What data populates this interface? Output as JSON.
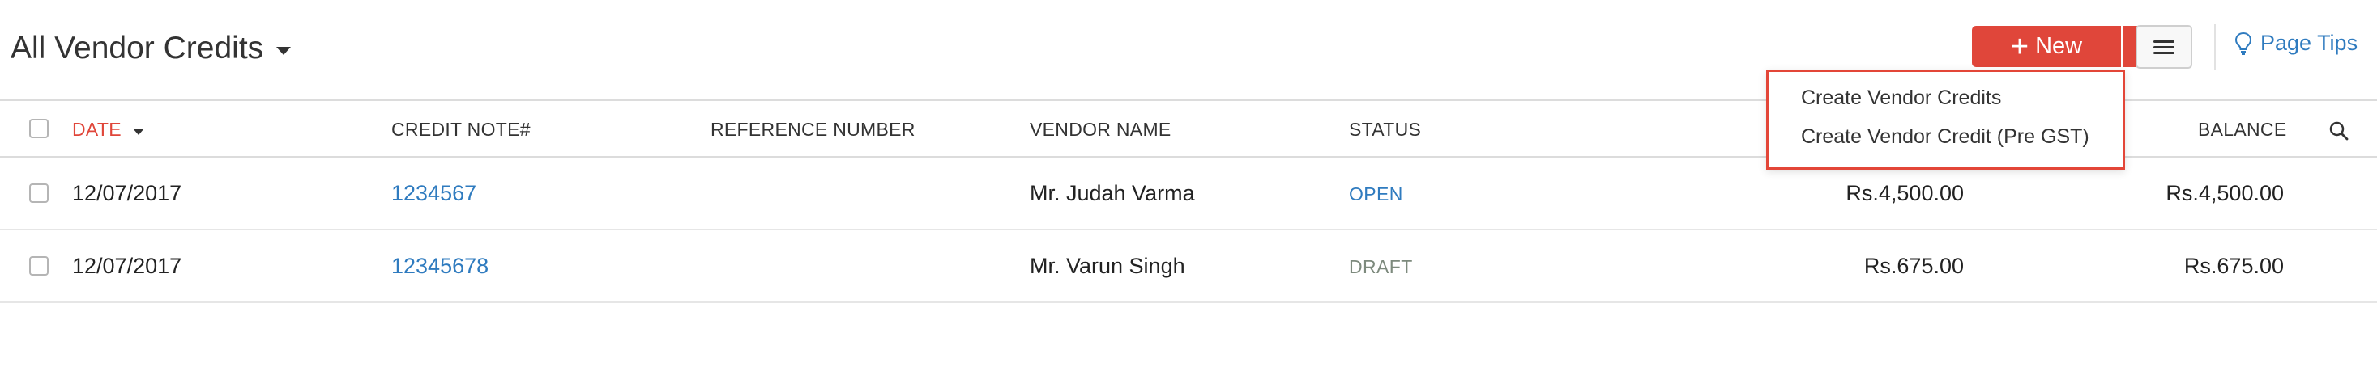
{
  "view": {
    "title": "All Vendor Credits"
  },
  "toolbar": {
    "new_label": "New",
    "page_tips_label": "Page Tips"
  },
  "new_menu": {
    "items": [
      "Create Vendor Credits",
      "Create Vendor Credit (Pre GST)"
    ]
  },
  "table": {
    "columns": {
      "date": "DATE",
      "credit_note": "CREDIT NOTE#",
      "reference_number": "REFERENCE NUMBER",
      "vendor_name": "VENDOR NAME",
      "status": "STATUS",
      "balance": "BALANCE"
    },
    "rows": [
      {
        "date": "12/07/2017",
        "credit_note": "1234567",
        "reference_number": "",
        "vendor_name": "Mr. Judah Varma",
        "status": "OPEN",
        "amount": "Rs.4,500.00",
        "balance": "Rs.4,500.00"
      },
      {
        "date": "12/07/2017",
        "credit_note": "12345678",
        "reference_number": "",
        "vendor_name": "Mr. Varun Singh",
        "status": "DRAFT",
        "amount": "Rs.675.00",
        "balance": "Rs.675.00"
      }
    ]
  },
  "colors": {
    "accent": "#e0463a",
    "link": "#2f7bbf",
    "status_open": "#2f7bbf",
    "status_draft": "#7d8a7d"
  },
  "icons": {
    "view_caret": "caret-down-icon",
    "new_plus": "plus-icon",
    "new_caret": "caret-down-icon",
    "menu": "hamburger-menu-icon",
    "page_tips": "lightbulb-icon",
    "sort": "sort-desc-icon",
    "search": "search-icon"
  }
}
